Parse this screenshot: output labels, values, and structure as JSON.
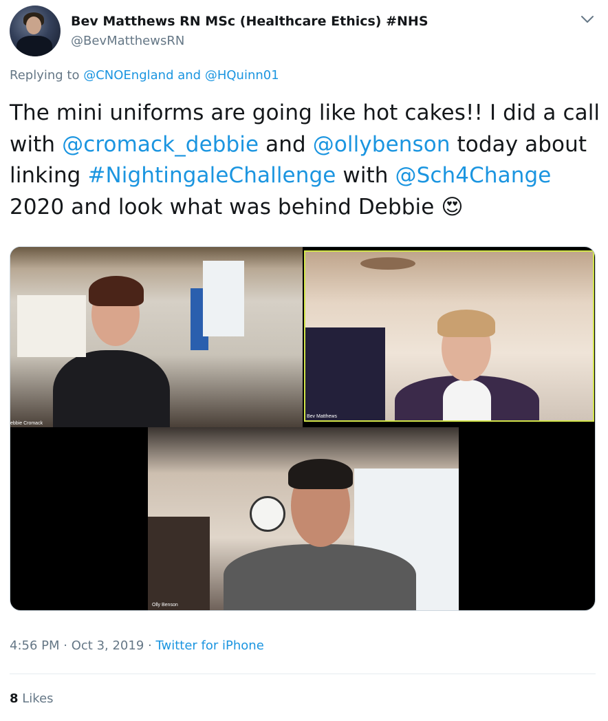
{
  "tweet": {
    "author": {
      "display_name": "Bev Matthews RN MSc (Healthcare Ethics) #NHS",
      "handle": "@BevMatthewsRN"
    },
    "reply": {
      "prefix": "Replying to",
      "mention1": "@CNOEngland",
      "and": "and",
      "mention2": "@HQuinn01"
    },
    "text": {
      "p1": "The mini uniforms are going like hot cakes!! I did a call with",
      "m1": "@cromack_debbie",
      "p2": "and",
      "m2": "@ollybenson",
      "p3": "today about linking",
      "tag": "#NightingaleChallenge",
      "p4": "with",
      "m3": "@Sch4Change",
      "p5": "2020 and look what was behind Debbie",
      "emoji": "😍"
    },
    "media": {
      "labels": [
        "ebbie Cromack",
        "Bev Matthews",
        "Olly Benson"
      ]
    },
    "footer": {
      "time": "4:56 PM",
      "sep1": "·",
      "date": "Oct 3, 2019",
      "sep2": "·",
      "source": "Twitter for iPhone"
    },
    "likes": {
      "count": "8",
      "label": "Likes"
    }
  },
  "colors": {
    "link": "#1b95e0",
    "secondary": "#657786",
    "text": "#14171a",
    "active_speaker": "#d3e54a"
  },
  "icons": {
    "menu": "chevron-down-icon"
  }
}
